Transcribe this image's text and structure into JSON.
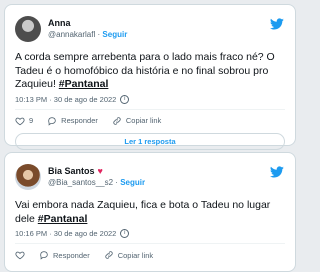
{
  "tweets": [
    {
      "name": "Anna",
      "handle": "@annakarlafl",
      "separator": "·",
      "follow_label": "Seguir",
      "text_main": "A corda sempre arrebenta para o lado mais fraco né? O Tadeu é o homofóbico da história e no final sobrou pro Zaquieu! ",
      "hashtag": "#Pantanal",
      "time": "10:13 PM · 30 de ago de 2022",
      "like_count": "9",
      "reply_label": "Responder",
      "copy_label": "Copiar link",
      "read_replies": "Ler 1 resposta"
    },
    {
      "name": "Bia Santos",
      "heart": "♥",
      "handle": "@Bia_santos__s2",
      "separator": "·",
      "follow_label": "Seguir",
      "text_main": "Vai embora nada Zaquieu, fica e bota o Tadeu no lugar dele ",
      "hashtag": "#Pantanal",
      "time": "10:16 PM · 30 de ago de 2022",
      "reply_label": "Responder",
      "copy_label": "Copiar link"
    }
  ]
}
